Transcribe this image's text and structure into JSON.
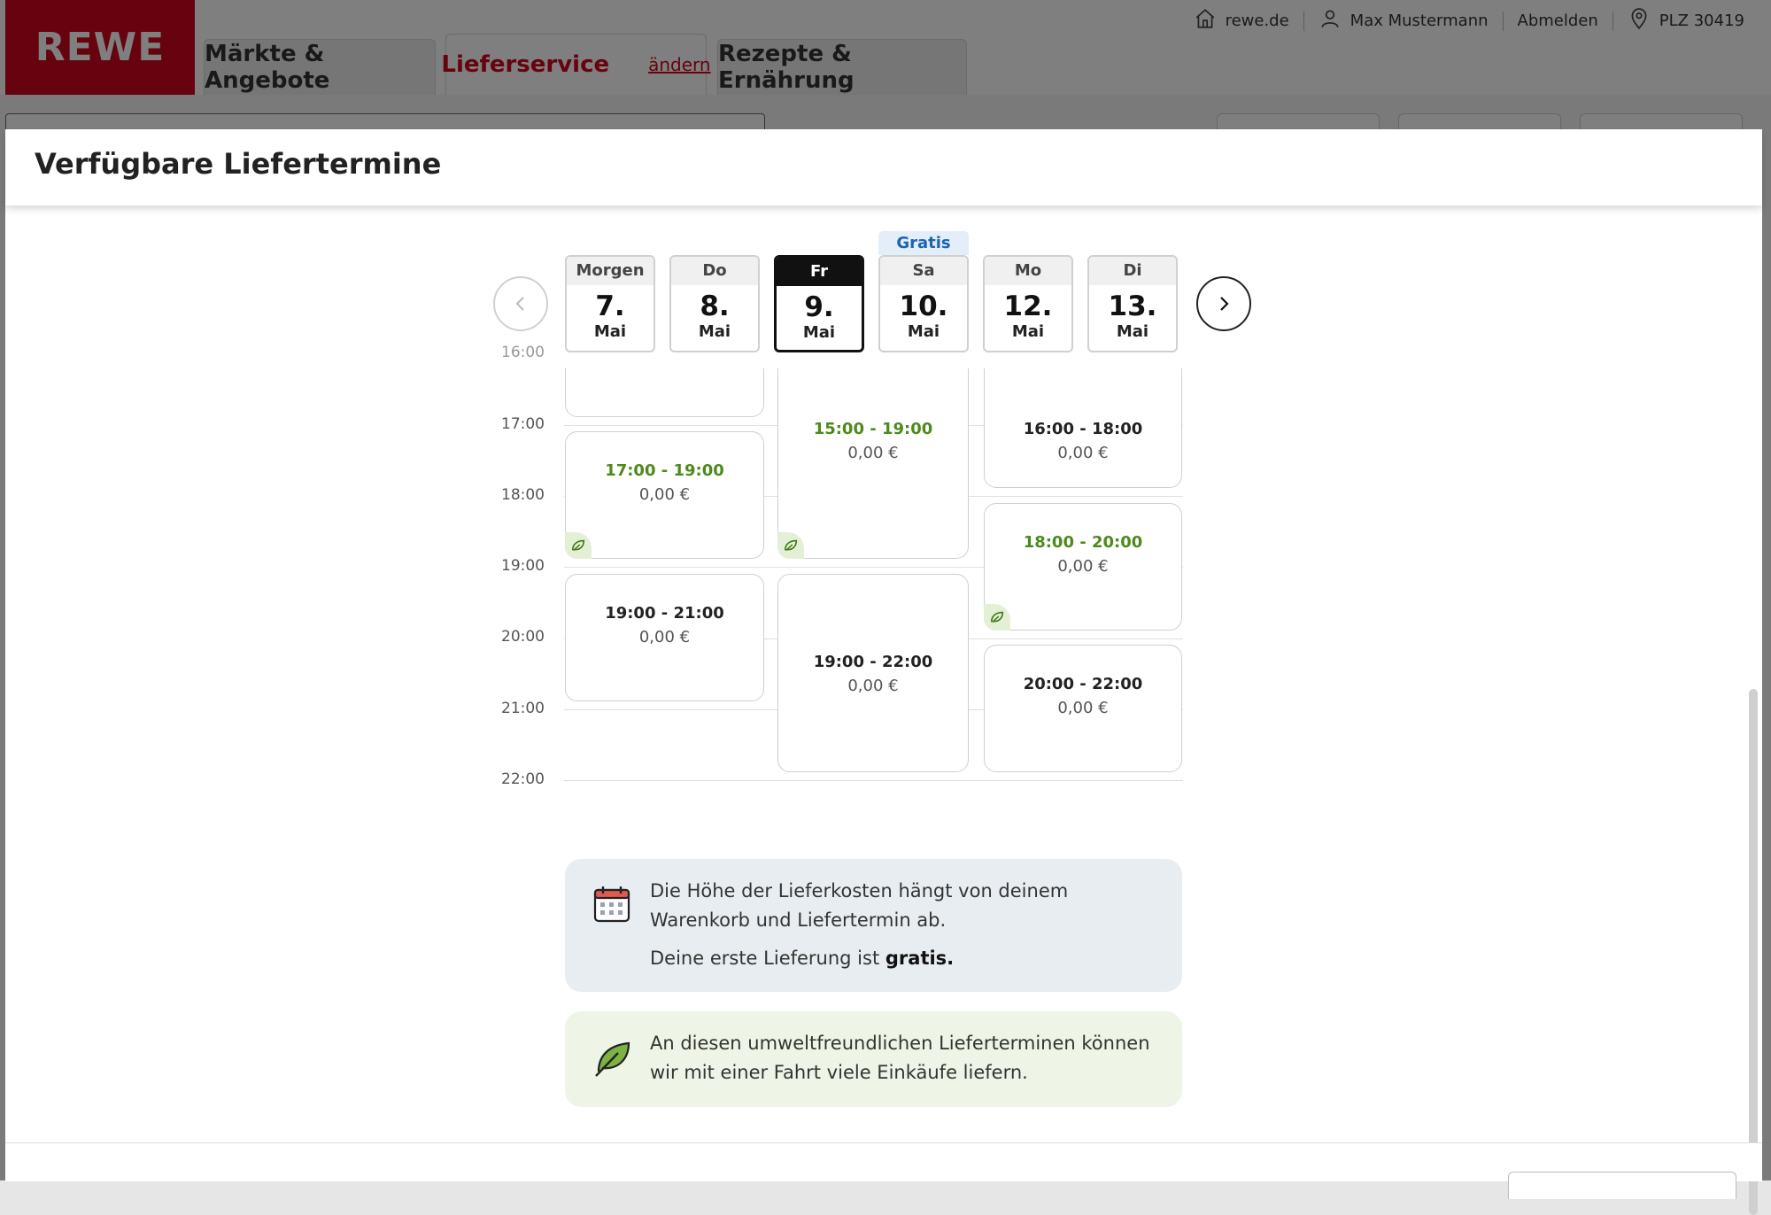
{
  "site": {
    "logo": "REWE",
    "nav": {
      "tab1": "Märkte & Angebote",
      "tab2": "Lieferservice",
      "tab2_change": "ändern",
      "tab3": "Rezepte & Ernährung"
    },
    "topbar": {
      "home": "rewe.de",
      "user": "Max Mustermann",
      "logout": "Abmelden",
      "location": "PLZ 30419"
    }
  },
  "modal": {
    "title": "Verfügbare Liefertermine",
    "gratis_label": "Gratis",
    "days": [
      {
        "name": "Morgen",
        "num": "7.",
        "month": "Mai"
      },
      {
        "name": "Do",
        "num": "8.",
        "month": "Mai"
      },
      {
        "name": "Fr",
        "num": "9.",
        "month": "Mai"
      },
      {
        "name": "Sa",
        "num": "10.",
        "month": "Mai"
      },
      {
        "name": "Mo",
        "num": "12.",
        "month": "Mai"
      },
      {
        "name": "Di",
        "num": "13.",
        "month": "Mai"
      }
    ],
    "time_labels": [
      "16:00",
      "17:00",
      "18:00",
      "19:00",
      "20:00",
      "21:00",
      "22:00"
    ],
    "slots": [
      {
        "time": "17:00 - 19:00",
        "price": "0,00 €"
      },
      {
        "time": "19:00 - 21:00",
        "price": "0,00 €"
      },
      {
        "time": "15:00 - 19:00",
        "price": "0,00 €"
      },
      {
        "time": "19:00 - 22:00",
        "price": "0,00 €"
      },
      {
        "time": "16:00 - 18:00",
        "price": "0,00 €"
      },
      {
        "time": "18:00 - 20:00",
        "price": "0,00 €"
      },
      {
        "time": "20:00 - 22:00",
        "price": "0,00 €"
      }
    ],
    "cost_info": {
      "line1": "Die Höhe der Lieferkosten hängt von deinem Warenkorb und Liefertermin ab.",
      "line2_prefix": "Deine erste Lieferung ist",
      "line2_bold": "gratis."
    },
    "eco_info": {
      "text": "An diesen umweltfreundlichen Lieferterminen können wir mit einer Fahrt viele Einkäufe liefern."
    }
  },
  "colors": {
    "brand_red": "#cc071e",
    "eco_green": "#4d8a1c",
    "gratis_blue": "#1a66b5"
  }
}
